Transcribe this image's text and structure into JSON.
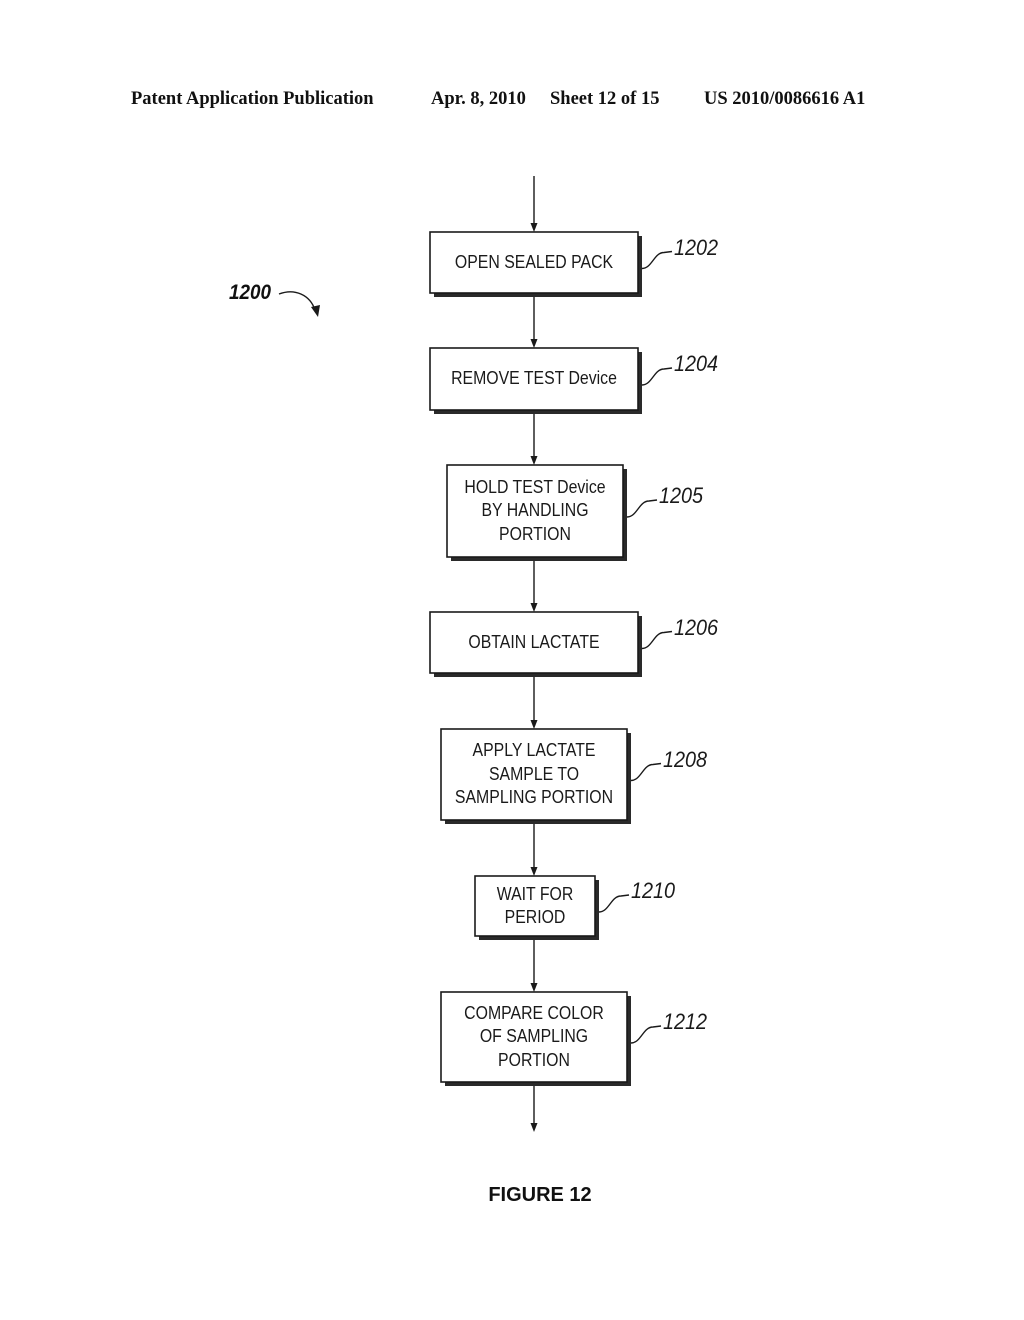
{
  "header": {
    "publication_type": "Patent Application Publication",
    "date": "Apr. 8, 2010",
    "sheet": "Sheet 12 of 15",
    "publication_number": "US 2010/0086616 A1"
  },
  "figure": {
    "reference": "1200",
    "caption": "FIGURE 12"
  },
  "flowchart": {
    "steps": [
      {
        "id": "1202",
        "lines": [
          "OPEN SEALED PACK"
        ]
      },
      {
        "id": "1204",
        "lines": [
          "REMOVE TEST Device"
        ]
      },
      {
        "id": "1205",
        "lines": [
          "HOLD TEST Device",
          "BY HANDLING",
          "PORTION"
        ]
      },
      {
        "id": "1206",
        "lines": [
          "OBTAIN LACTATE"
        ]
      },
      {
        "id": "1208",
        "lines": [
          "APPLY LACTATE",
          "SAMPLE TO",
          "SAMPLING PORTION"
        ]
      },
      {
        "id": "1210",
        "lines": [
          "WAIT FOR",
          "PERIOD"
        ]
      },
      {
        "id": "1212",
        "lines": [
          "COMPARE COLOR",
          "OF SAMPLING",
          "PORTION"
        ]
      }
    ]
  }
}
